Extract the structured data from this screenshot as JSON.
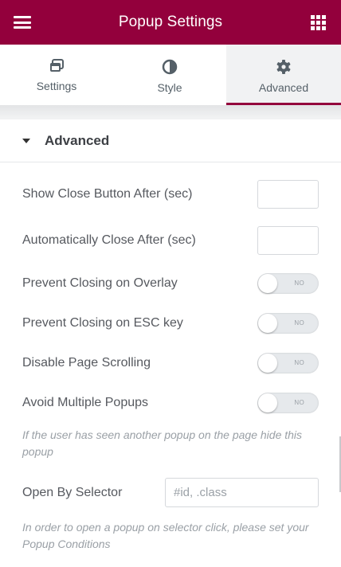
{
  "header": {
    "title": "Popup Settings",
    "menu_icon": "hamburger-icon",
    "apps_icon": "grid-icon",
    "bg_color": "#93003c"
  },
  "tabs": [
    {
      "label": "Settings",
      "icon": "window-icon",
      "active": false
    },
    {
      "label": "Style",
      "icon": "half-circle-icon",
      "active": false
    },
    {
      "label": "Advanced",
      "icon": "gear-icon",
      "active": true
    }
  ],
  "section": {
    "title": "Advanced",
    "expanded": true
  },
  "fields": {
    "show_close_after": {
      "label": "Show Close Button After (sec)",
      "value": ""
    },
    "auto_close_after": {
      "label": "Automatically Close After (sec)",
      "value": ""
    },
    "prevent_overlay": {
      "label": "Prevent Closing on Overlay",
      "state": "NO"
    },
    "prevent_esc": {
      "label": "Prevent Closing on ESC key",
      "state": "NO"
    },
    "disable_scroll": {
      "label": "Disable Page Scrolling",
      "state": "NO"
    },
    "avoid_multiple": {
      "label": "Avoid Multiple Popups",
      "state": "NO"
    },
    "avoid_multiple_note": "If the user has seen another popup on the page hide this popup",
    "open_by_selector": {
      "label": "Open By Selector",
      "placeholder": "#id, .class",
      "value": ""
    },
    "open_by_selector_note": "In order to open a popup on selector click, please set your Popup Conditions"
  }
}
